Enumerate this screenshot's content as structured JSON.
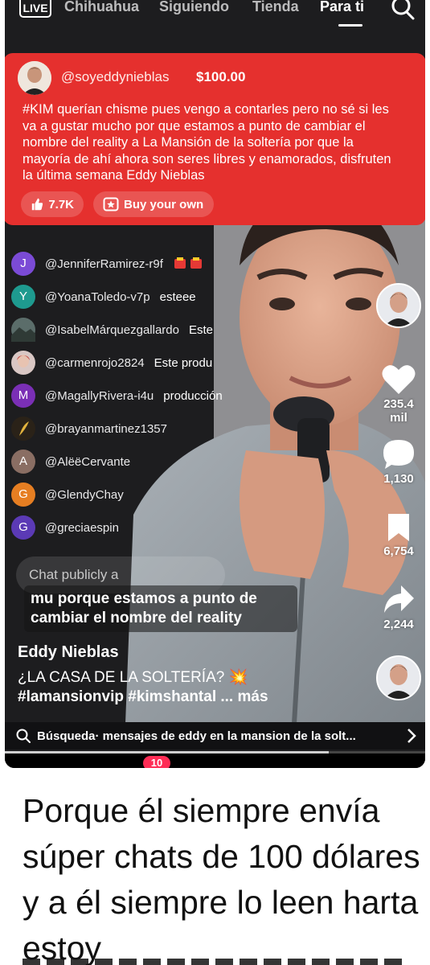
{
  "top_nav": {
    "live": "LIVE",
    "tabs": [
      "Chihuahua",
      "Siguiendo",
      "Tienda",
      "Para ti"
    ],
    "active_tab": "Para ti"
  },
  "super_chat": {
    "username": "@soyeddynieblas",
    "amount": "$100.00",
    "message": "#KIM querían chisme pues vengo a contarles pero no sé si les va a gustar mucho por que estamos a punto de cambiar el nombre del reality a La Mansión de la soltería por que la mayoría de ahí ahora son seres libres y enamorados, disfruten la última semana Eddy Nieblas",
    "likes": "7.7K",
    "buy_label": "Buy your own",
    "color": "#e5302e"
  },
  "chat": [
    {
      "initial": "J",
      "color": "#7b4bd6",
      "user": "@JenniferRamirez-r9f",
      "text": ""
    },
    {
      "initial": "Y",
      "color": "#1e9a8f",
      "user": "@YoanaToledo-v7p",
      "text": "esteee"
    },
    {
      "initial": "",
      "color": "#5b6d6a",
      "user": "@IsabelMárquezgallardo",
      "text": "Este"
    },
    {
      "initial": "",
      "color": "#d9c7c4",
      "user": "@carmenrojo2824",
      "text": "Este produ"
    },
    {
      "initial": "M",
      "color": "#7a2fb5",
      "user": "@MagallyRivera-i4u",
      "text": "producción"
    },
    {
      "initial": "",
      "color": "#2a2218",
      "user": "@brayanmartinez1357",
      "text": ""
    },
    {
      "initial": "A",
      "color": "#8a6e63",
      "user": "@AlëëCervante",
      "text": ""
    },
    {
      "initial": "G",
      "color": "#e67e22",
      "user": "@GlendyChay",
      "text": ""
    },
    {
      "initial": "G",
      "color": "#5b3ab5",
      "user": "@greciaespin",
      "text": ""
    }
  ],
  "actions": {
    "likes": "235.4 mil",
    "comments": "1,130",
    "saves": "6,754",
    "shares": "2,244"
  },
  "input": {
    "placeholder": "Chat publicly a"
  },
  "caption_overlay": "mu porque estamos a punto de cambiar el nombre del reality",
  "post": {
    "author": "Eddy Nieblas",
    "title": "¿LA CASA DE LA SOLTERÍA? 💥",
    "hashtags": "#lamansionvip #kimshantal",
    "more": "... más"
  },
  "search": {
    "label": "Búsqueda",
    "query": " · mensajes de eddy en la mansion de la solt..."
  },
  "bottom_nav": {
    "badge": "10"
  },
  "progress": 0.77,
  "bottom_text": "Porque él siempre envía súper chats de 100 dólares y a él siempre lo leen harta estoy"
}
